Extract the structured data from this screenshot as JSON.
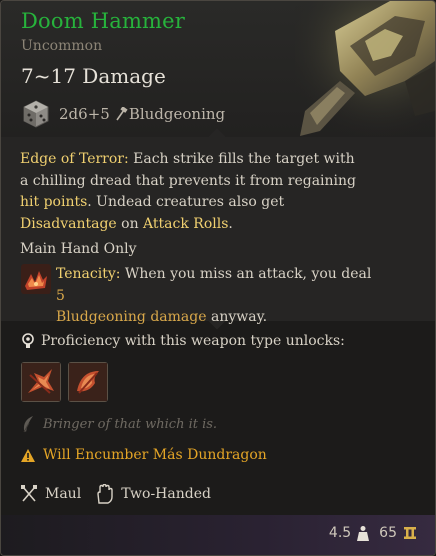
{
  "item": {
    "name": "Doom Hammer",
    "rarity": "Uncommon",
    "damage": "7~17 Damage",
    "dice": "2d6+5",
    "damage_type": "Bludgeoning"
  },
  "description": {
    "edge_title": "Edge of Terror:",
    "edge_text_1": " Each strike fills the target with a chilling dread that prevents it from regaining ",
    "kw_hit_points": "hit points",
    "edge_text_2": ". Undead creatures also get ",
    "kw_disadvantage": "Disadvantage",
    "edge_text_3": " on ",
    "kw_attack_rolls": "Attack Rolls",
    "edge_text_4": ".",
    "main_hand": "Main Hand Only",
    "tenacity_title": "Tenacity:",
    "tenacity_text_1": " When you miss an attack, you deal ",
    "tenacity_number": "5",
    "tenacity_damage": "Bludgeoning damage",
    "tenacity_text_2": " anyway."
  },
  "proficiency": {
    "label": "Proficiency with this weapon type unlocks:",
    "skills": [
      "skill-1",
      "skill-2"
    ]
  },
  "flavor": "Bringer of that which it is.",
  "warning": "Will Encumber Más Dundragon",
  "tags": {
    "weapon_type": "Maul",
    "handedness": "Two-Handed"
  },
  "footer": {
    "weight": "4.5",
    "price": "65"
  },
  "colors": {
    "name": "#27b33c",
    "keyword": "#f0d070",
    "warning": "#e4a526"
  }
}
